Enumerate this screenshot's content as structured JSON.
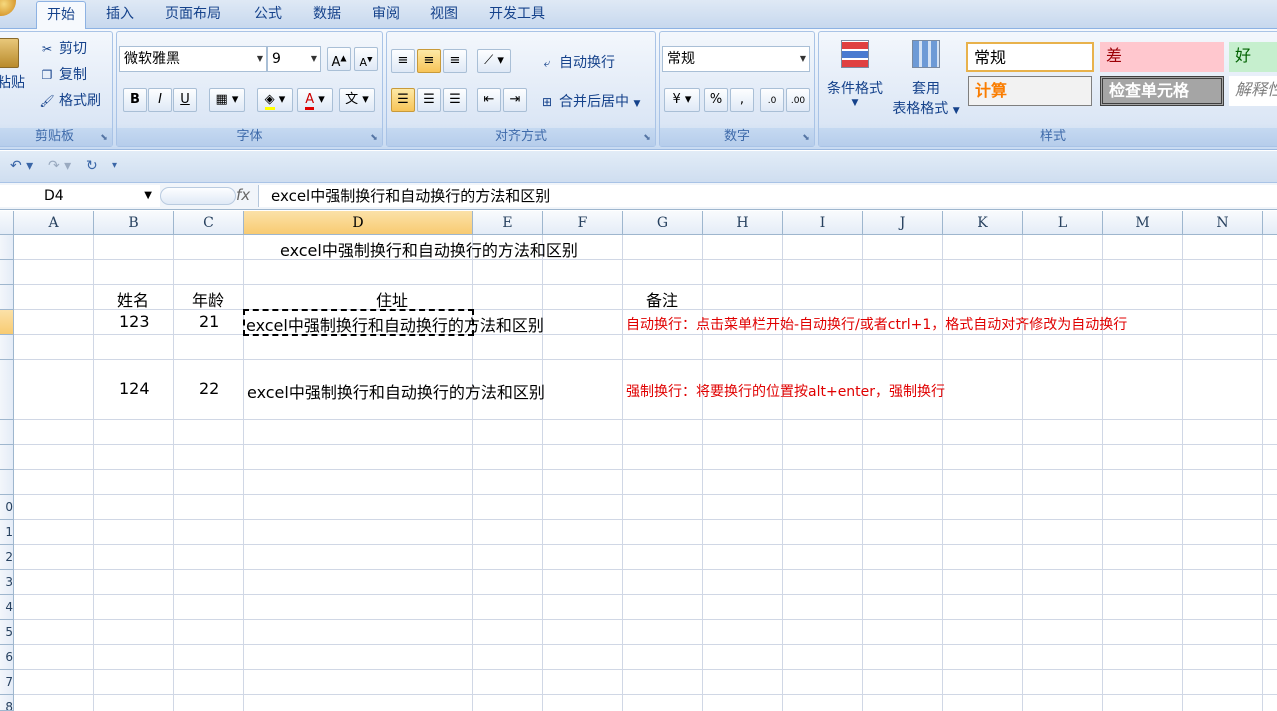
{
  "tabs": [
    "开始",
    "插入",
    "页面布局",
    "公式",
    "数据",
    "审阅",
    "视图",
    "开发工具"
  ],
  "ribbon": {
    "clipboard": {
      "paste": "粘贴",
      "cut": "剪切",
      "copy": "复制",
      "format_painter": "格式刷",
      "label": "剪贴板"
    },
    "font": {
      "font_name": "微软雅黑",
      "font_size": "9",
      "bold": "B",
      "italic": "I",
      "underline": "U",
      "label": "字体"
    },
    "alignment": {
      "wrap_text": "自动换行",
      "merge_center": "合并后居中",
      "label": "对齐方式"
    },
    "number": {
      "format": "常规",
      "percent": "%",
      "comma": ",",
      "label": "数字"
    },
    "conditional": {
      "cond_format": "条件格式",
      "table_format_1": "套用",
      "table_format_2": "表格格式"
    },
    "styles": {
      "normal": "常规",
      "bad": "差",
      "good": "好",
      "calc": "计算",
      "check": "检查单元格",
      "explain": "解释性",
      "label": "样式"
    }
  },
  "formula_bar": {
    "name_box": "D4",
    "fx": "fx",
    "formula": "excel中强制换行和自动换行的方法和区别"
  },
  "columns": [
    "A",
    "B",
    "C",
    "D",
    "E",
    "F",
    "G",
    "H",
    "I",
    "J",
    "K",
    "L",
    "M",
    "N"
  ],
  "row_numbers": [
    "0",
    "1",
    "2",
    "3",
    "4",
    "5",
    "6",
    "7",
    "8"
  ],
  "cells": {
    "title": "excel中强制换行和自动换行的方法和区别",
    "h_name": "姓名",
    "h_age": "年龄",
    "h_addr": "住址",
    "h_note": "备注",
    "r1_name": "123",
    "r1_age": "21",
    "r1_addr": "excel中强制换行和自动换行的方法和区别",
    "r1_note": "自动换行：点击菜单栏开始-自动换行/或者ctrl+1，格式自动对齐修改为自动换行",
    "r2_name": "124",
    "r2_age": "22",
    "r2_addr": "excel中强制换行和自动换行的方法和区别",
    "r2_note": "强制换行：将要换行的位置按alt+enter，强制换行"
  },
  "colors": {
    "accent": "#15428b",
    "note_red": "#e00000",
    "selection": "#f8cb72"
  }
}
